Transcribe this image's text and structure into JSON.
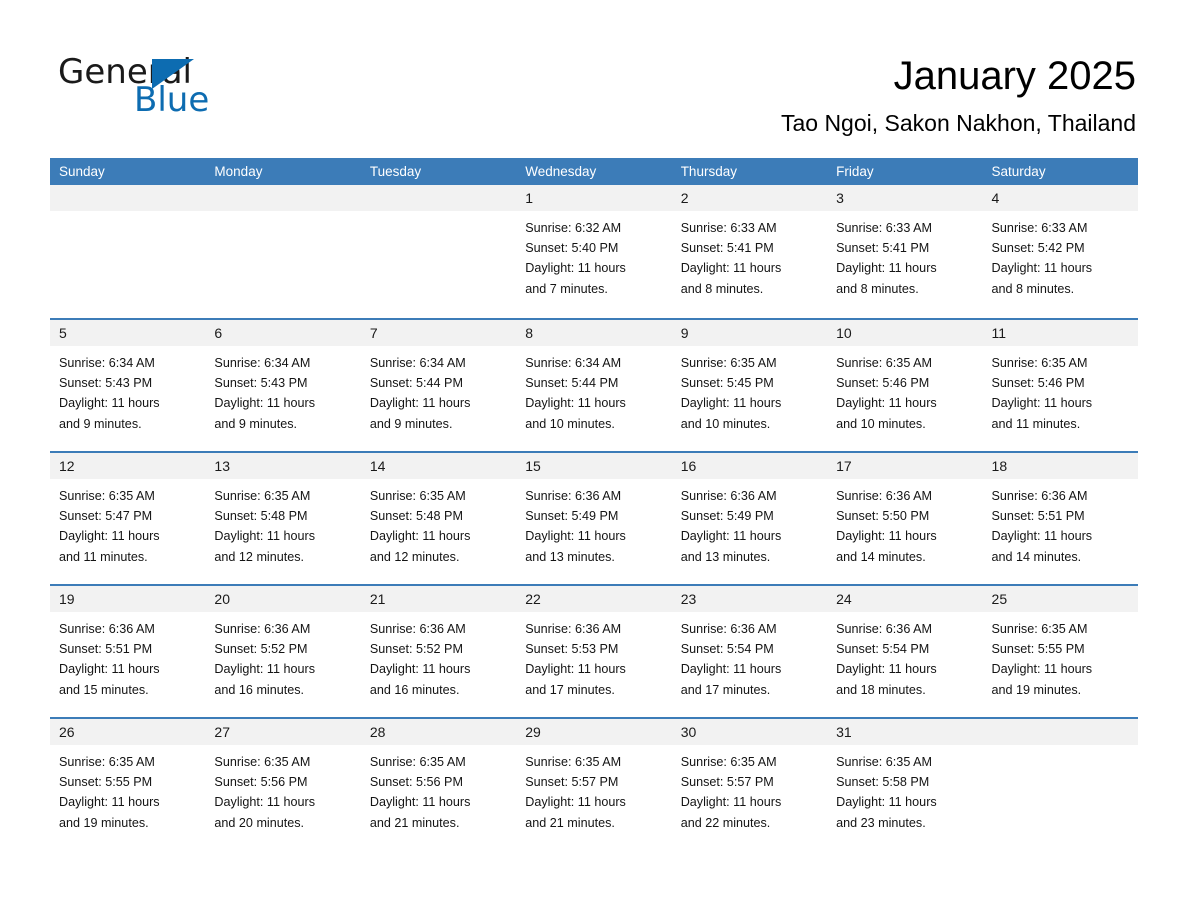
{
  "brand": {
    "word_one": "General",
    "word_two": "Blue",
    "triangle_icon": "triangle-right-icon",
    "accent_color": "#0d6cb1"
  },
  "header": {
    "month_title": "January 2025",
    "location": "Tao Ngoi, Sakon Nakhon, Thailand"
  },
  "calendar": {
    "header_bg": "#3c7cb8",
    "row_border_color": "#3c7cb8",
    "day_strip_bg": "#f2f2f2",
    "weekdays": [
      "Sunday",
      "Monday",
      "Tuesday",
      "Wednesday",
      "Thursday",
      "Friday",
      "Saturday"
    ],
    "weeks": [
      [
        {
          "day": "",
          "lines": []
        },
        {
          "day": "",
          "lines": []
        },
        {
          "day": "",
          "lines": []
        },
        {
          "day": "1",
          "lines": [
            "Sunrise: 6:32 AM",
            "Sunset: 5:40 PM",
            "Daylight: 11 hours",
            "and 7 minutes."
          ]
        },
        {
          "day": "2",
          "lines": [
            "Sunrise: 6:33 AM",
            "Sunset: 5:41 PM",
            "Daylight: 11 hours",
            "and 8 minutes."
          ]
        },
        {
          "day": "3",
          "lines": [
            "Sunrise: 6:33 AM",
            "Sunset: 5:41 PM",
            "Daylight: 11 hours",
            "and 8 minutes."
          ]
        },
        {
          "day": "4",
          "lines": [
            "Sunrise: 6:33 AM",
            "Sunset: 5:42 PM",
            "Daylight: 11 hours",
            "and 8 minutes."
          ]
        }
      ],
      [
        {
          "day": "5",
          "lines": [
            "Sunrise: 6:34 AM",
            "Sunset: 5:43 PM",
            "Daylight: 11 hours",
            "and 9 minutes."
          ]
        },
        {
          "day": "6",
          "lines": [
            "Sunrise: 6:34 AM",
            "Sunset: 5:43 PM",
            "Daylight: 11 hours",
            "and 9 minutes."
          ]
        },
        {
          "day": "7",
          "lines": [
            "Sunrise: 6:34 AM",
            "Sunset: 5:44 PM",
            "Daylight: 11 hours",
            "and 9 minutes."
          ]
        },
        {
          "day": "8",
          "lines": [
            "Sunrise: 6:34 AM",
            "Sunset: 5:44 PM",
            "Daylight: 11 hours",
            "and 10 minutes."
          ]
        },
        {
          "day": "9",
          "lines": [
            "Sunrise: 6:35 AM",
            "Sunset: 5:45 PM",
            "Daylight: 11 hours",
            "and 10 minutes."
          ]
        },
        {
          "day": "10",
          "lines": [
            "Sunrise: 6:35 AM",
            "Sunset: 5:46 PM",
            "Daylight: 11 hours",
            "and 10 minutes."
          ]
        },
        {
          "day": "11",
          "lines": [
            "Sunrise: 6:35 AM",
            "Sunset: 5:46 PM",
            "Daylight: 11 hours",
            "and 11 minutes."
          ]
        }
      ],
      [
        {
          "day": "12",
          "lines": [
            "Sunrise: 6:35 AM",
            "Sunset: 5:47 PM",
            "Daylight: 11 hours",
            "and 11 minutes."
          ]
        },
        {
          "day": "13",
          "lines": [
            "Sunrise: 6:35 AM",
            "Sunset: 5:48 PM",
            "Daylight: 11 hours",
            "and 12 minutes."
          ]
        },
        {
          "day": "14",
          "lines": [
            "Sunrise: 6:35 AM",
            "Sunset: 5:48 PM",
            "Daylight: 11 hours",
            "and 12 minutes."
          ]
        },
        {
          "day": "15",
          "lines": [
            "Sunrise: 6:36 AM",
            "Sunset: 5:49 PM",
            "Daylight: 11 hours",
            "and 13 minutes."
          ]
        },
        {
          "day": "16",
          "lines": [
            "Sunrise: 6:36 AM",
            "Sunset: 5:49 PM",
            "Daylight: 11 hours",
            "and 13 minutes."
          ]
        },
        {
          "day": "17",
          "lines": [
            "Sunrise: 6:36 AM",
            "Sunset: 5:50 PM",
            "Daylight: 11 hours",
            "and 14 minutes."
          ]
        },
        {
          "day": "18",
          "lines": [
            "Sunrise: 6:36 AM",
            "Sunset: 5:51 PM",
            "Daylight: 11 hours",
            "and 14 minutes."
          ]
        }
      ],
      [
        {
          "day": "19",
          "lines": [
            "Sunrise: 6:36 AM",
            "Sunset: 5:51 PM",
            "Daylight: 11 hours",
            "and 15 minutes."
          ]
        },
        {
          "day": "20",
          "lines": [
            "Sunrise: 6:36 AM",
            "Sunset: 5:52 PM",
            "Daylight: 11 hours",
            "and 16 minutes."
          ]
        },
        {
          "day": "21",
          "lines": [
            "Sunrise: 6:36 AM",
            "Sunset: 5:52 PM",
            "Daylight: 11 hours",
            "and 16 minutes."
          ]
        },
        {
          "day": "22",
          "lines": [
            "Sunrise: 6:36 AM",
            "Sunset: 5:53 PM",
            "Daylight: 11 hours",
            "and 17 minutes."
          ]
        },
        {
          "day": "23",
          "lines": [
            "Sunrise: 6:36 AM",
            "Sunset: 5:54 PM",
            "Daylight: 11 hours",
            "and 17 minutes."
          ]
        },
        {
          "day": "24",
          "lines": [
            "Sunrise: 6:36 AM",
            "Sunset: 5:54 PM",
            "Daylight: 11 hours",
            "and 18 minutes."
          ]
        },
        {
          "day": "25",
          "lines": [
            "Sunrise: 6:35 AM",
            "Sunset: 5:55 PM",
            "Daylight: 11 hours",
            "and 19 minutes."
          ]
        }
      ],
      [
        {
          "day": "26",
          "lines": [
            "Sunrise: 6:35 AM",
            "Sunset: 5:55 PM",
            "Daylight: 11 hours",
            "and 19 minutes."
          ]
        },
        {
          "day": "27",
          "lines": [
            "Sunrise: 6:35 AM",
            "Sunset: 5:56 PM",
            "Daylight: 11 hours",
            "and 20 minutes."
          ]
        },
        {
          "day": "28",
          "lines": [
            "Sunrise: 6:35 AM",
            "Sunset: 5:56 PM",
            "Daylight: 11 hours",
            "and 21 minutes."
          ]
        },
        {
          "day": "29",
          "lines": [
            "Sunrise: 6:35 AM",
            "Sunset: 5:57 PM",
            "Daylight: 11 hours",
            "and 21 minutes."
          ]
        },
        {
          "day": "30",
          "lines": [
            "Sunrise: 6:35 AM",
            "Sunset: 5:57 PM",
            "Daylight: 11 hours",
            "and 22 minutes."
          ]
        },
        {
          "day": "31",
          "lines": [
            "Sunrise: 6:35 AM",
            "Sunset: 5:58 PM",
            "Daylight: 11 hours",
            "and 23 minutes."
          ]
        },
        {
          "day": "",
          "lines": []
        }
      ]
    ]
  }
}
